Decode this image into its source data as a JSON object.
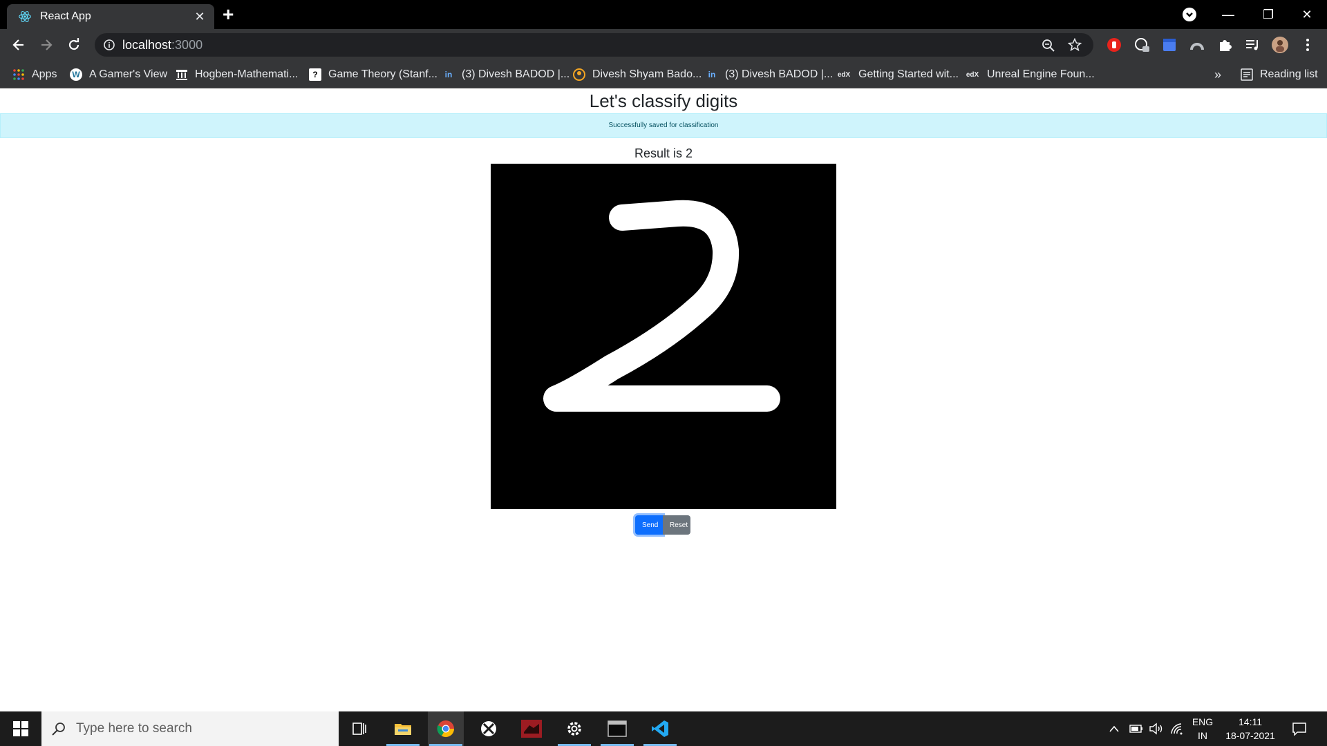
{
  "browser": {
    "tab_title": "React App",
    "url_host": "localhost",
    "url_port": ":3000"
  },
  "bookmarks": [
    {
      "label": "Apps",
      "icon": "apps-grid-icon"
    },
    {
      "label": "A Gamer's View",
      "icon": "wordpress-icon"
    },
    {
      "label": "Hogben-Mathemati...",
      "icon": "institution-icon"
    },
    {
      "label": "Game Theory (Stanf...",
      "icon": "game-theory-icon"
    },
    {
      "label": "(3) Divesh BADOD |...",
      "icon": "linkedin-icon"
    },
    {
      "label": "Divesh Shyam Bado...",
      "icon": "profile-icon"
    },
    {
      "label": "(3) Divesh BADOD |...",
      "icon": "linkedin-icon"
    },
    {
      "label": "Getting Started wit...",
      "icon": "edx-icon"
    },
    {
      "label": "Unreal Engine Foun...",
      "icon": "edx-icon"
    }
  ],
  "bookmarks_overflow": "»",
  "reading_list": "Reading list",
  "page": {
    "heading": "Let's classify digits",
    "alert": "Successfully saved for classification",
    "result": "Result is 2",
    "send_label": "Send",
    "reset_label": "Reset"
  },
  "taskbar": {
    "search_placeholder": "Type here to search",
    "lang_top": "ENG",
    "lang_bottom": "IN",
    "time": "14:11",
    "date": "18-07-2021"
  },
  "colors": {
    "primary": "#0d6efd",
    "secondary": "#6c757d",
    "alert_bg": "#cff4fc"
  }
}
